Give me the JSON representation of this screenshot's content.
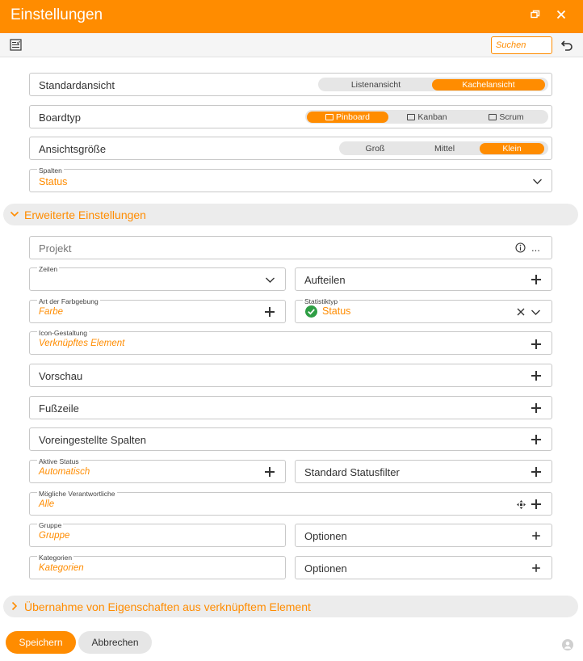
{
  "window": {
    "title": "Einstellungen",
    "restore_icon": "restore-icon",
    "close_icon": "close-icon"
  },
  "toolbar": {
    "search_placeholder": "Suchen"
  },
  "standardansicht": {
    "label": "Standardansicht",
    "options": [
      "Listenansicht",
      "Kachelansicht"
    ],
    "selected": "Kachelansicht"
  },
  "boardtyp": {
    "label": "Boardtyp",
    "options": [
      "Pinboard",
      "Kanban",
      "Scrum"
    ],
    "selected": "Pinboard"
  },
  "ansichtsgroesse": {
    "label": "Ansichtsgröße",
    "options": [
      "Groß",
      "Mittel",
      "Klein"
    ],
    "selected": "Klein"
  },
  "spalten": {
    "label": "Spalten",
    "value": "Status"
  },
  "erweitert": {
    "title": "Erweiterte Einstellungen",
    "projekt": {
      "placeholder": "Projekt",
      "more": "..."
    },
    "zeilen": {
      "label": "Zeilen"
    },
    "aufteilen": {
      "label": "Aufteilen"
    },
    "farbgebung": {
      "label": "Art der Farbgebung",
      "value": "Farbe"
    },
    "statistiktyp": {
      "label": "Statistiktyp",
      "value": "Status"
    },
    "icon_gestaltung": {
      "label": "Icon-Gestaltung",
      "value": "Verknüpftes Element"
    },
    "vorschau": {
      "label": "Vorschau"
    },
    "fusszeile": {
      "label": "Fußzeile"
    },
    "voreingestellte": {
      "label": "Voreingestellte Spalten"
    },
    "aktive_status": {
      "label": "Aktive Status",
      "value": "Automatisch"
    },
    "standard_statusfilter": {
      "label": "Standard Statusfilter"
    },
    "verantwortliche": {
      "label": "Mögliche Verantwortliche",
      "value": "Alle"
    },
    "gruppe": {
      "label": "Gruppe",
      "value": "Gruppe"
    },
    "gruppe_optionen": {
      "label": "Optionen"
    },
    "kategorien": {
      "label": "Kategorien",
      "value": "Kategorien"
    },
    "kategorien_optionen": {
      "label": "Optionen"
    }
  },
  "uebernahme": {
    "title": "Übernahme von Eigenschaften aus verknüpftem Element"
  },
  "footer": {
    "save": "Speichern",
    "cancel": "Abbrechen"
  },
  "colors": {
    "accent": "#ff8c00",
    "status_green": "#2e9e44"
  }
}
